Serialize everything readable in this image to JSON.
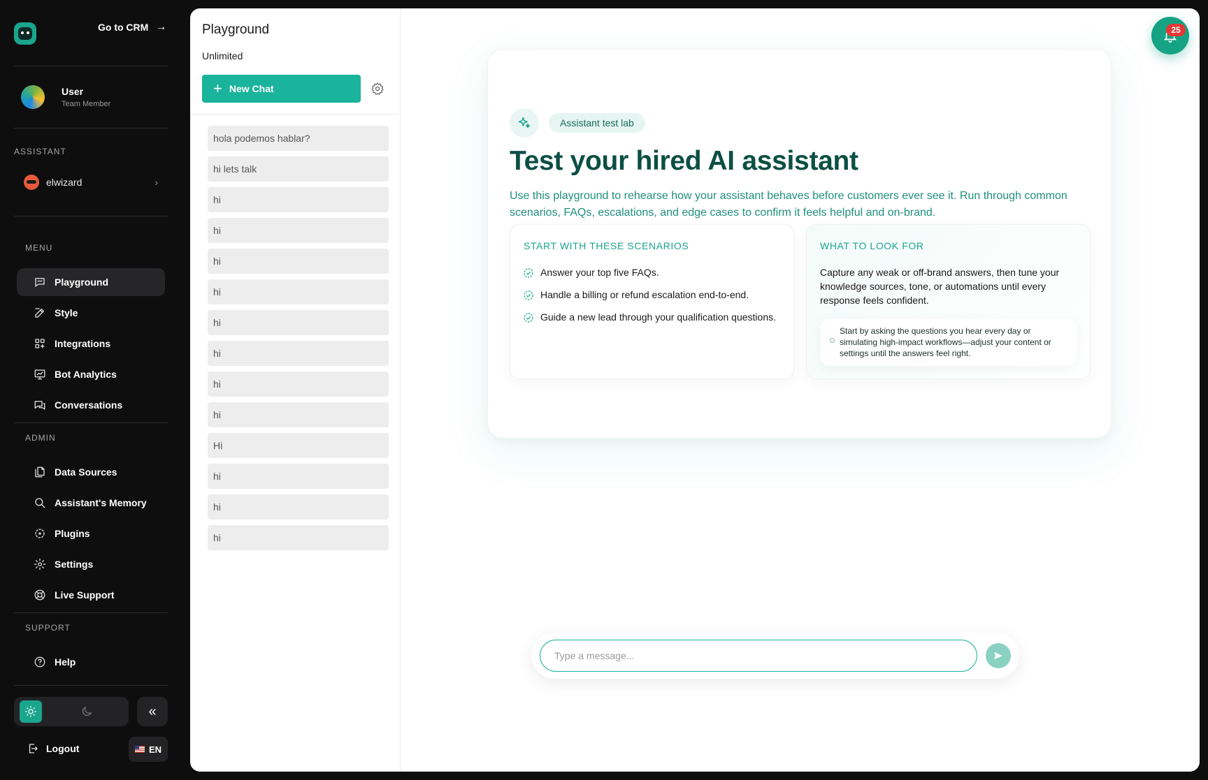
{
  "sidebar": {
    "go_crm_label": "Go to CRM",
    "user": {
      "name": "User",
      "role": "Team Member"
    },
    "assistant_label": "ASSISTANT",
    "assistant_name": "elwizard",
    "menu_label": "MENU",
    "menu_items": [
      {
        "label": "Playground",
        "icon": "chat-bubble-icon"
      },
      {
        "label": "Style",
        "icon": "edit-icon"
      },
      {
        "label": "Integrations",
        "icon": "integrations-icon"
      },
      {
        "label": "Bot Analytics",
        "icon": "analytics-icon"
      },
      {
        "label": "Conversations",
        "icon": "conversations-icon"
      }
    ],
    "admin_label": "ADMIN",
    "admin_items": [
      {
        "label": "Data Sources",
        "icon": "files-icon"
      },
      {
        "label": "Assistant's Memory",
        "icon": "search-icon"
      },
      {
        "label": "Plugins",
        "icon": "plugins-icon"
      },
      {
        "label": "Settings",
        "icon": "gear-icon"
      },
      {
        "label": "Live Support",
        "icon": "lifebuoy-icon"
      }
    ],
    "support_label": "SUPPORT",
    "support_items": [
      {
        "label": "Help",
        "icon": "help-icon"
      }
    ],
    "logout_label": "Logout",
    "language": "EN"
  },
  "history": {
    "title": "Playground",
    "plan": "Unlimited",
    "new_chat_label": "New Chat",
    "items": [
      "hola podemos hablar?",
      "hi lets talk",
      "hi",
      "hi",
      "hi",
      "hi",
      "hi",
      "hi",
      "hi",
      "hi",
      "Hi",
      "hi",
      "hi",
      "hi"
    ]
  },
  "intro": {
    "pill": "Assistant test lab",
    "headline": "Test your hired AI assistant",
    "lead": "Use this playground to rehearse how your assistant behaves before customers ever see it. Run through common scenarios, FAQs, escalations, and edge cases to confirm it feels helpful and on-brand.",
    "scenarios_title": "START WITH THESE SCENARIOS",
    "scenarios": [
      "Answer your top five FAQs.",
      "Handle a billing or refund escalation end-to-end.",
      "Guide a new lead through your qualification questions."
    ],
    "look_title": "WHAT TO LOOK FOR",
    "look_text": "Capture any weak or off-brand answers, then tune your knowledge sources, tone, or automations until every response feels confident.",
    "tip": "Start by asking the questions you hear every day or simulating high-impact workflows—adjust your content or settings until the answers feel right."
  },
  "notifications": {
    "count": "25"
  },
  "composer": {
    "placeholder": "Type a message..."
  },
  "colors": {
    "accent": "#1ab39b",
    "headline": "#0c4f43",
    "sidebar_bg": "#0e0e0f"
  }
}
